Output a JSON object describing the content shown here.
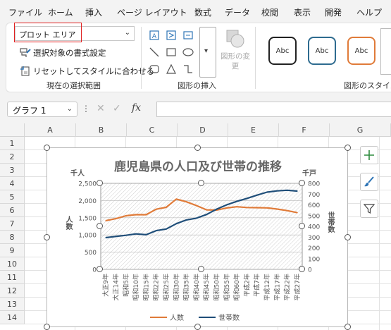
{
  "menubar": {
    "items": [
      {
        "label": "ファイル"
      },
      {
        "label": "ホーム"
      },
      {
        "label": "挿入"
      },
      {
        "label": "ページ レイアウト"
      },
      {
        "label": "数式"
      },
      {
        "label": "データ"
      },
      {
        "label": "校閲"
      },
      {
        "label": "表示"
      },
      {
        "label": "開発"
      },
      {
        "label": "ヘルプ"
      }
    ]
  },
  "ribbon": {
    "current_selection": {
      "element_select_value": "プロット エリア",
      "format_selection_label": "選択対象の書式設定",
      "reset_style_label": "リセットしてスタイルに合わせる",
      "group_label": "現在の選択範囲"
    },
    "insert_shapes": {
      "group_label": "図形の挿入",
      "change_shape_label": "図形の変更"
    },
    "shape_styles": {
      "group_label": "図形のスタイル",
      "style_sample": "Abc",
      "style_border_colors": [
        "#222222",
        "#2e6b8f",
        "#e07b39"
      ]
    }
  },
  "formula_bar": {
    "name_box": "グラフ 1",
    "fx_label": "fx",
    "formula": ""
  },
  "grid": {
    "columns": [
      "A",
      "B",
      "C",
      "D",
      "E",
      "F",
      "G"
    ],
    "rows": [
      "1",
      "2",
      "3",
      "4",
      "5",
      "6",
      "7",
      "8",
      "9",
      "10",
      "11",
      "12",
      "13",
      "14"
    ]
  },
  "chart": {
    "title": "鹿児島県の人口及び世帯の推移",
    "left_unit": "千人",
    "right_unit": "千戸",
    "left_axis_title": "人数",
    "right_axis_title": "世帯数",
    "legend": [
      {
        "name": "人数",
        "color": "#e07b39"
      },
      {
        "name": "世帯数",
        "color": "#1f4e79"
      }
    ]
  },
  "chart_data": {
    "type": "line",
    "title": "鹿児島県の人口及び世帯の推移",
    "categories": [
      "大正9年",
      "大正14年",
      "昭和5年",
      "昭和10年",
      "昭和15年",
      "昭和22年",
      "昭和25年",
      "昭和30年",
      "昭和35年",
      "昭和40年",
      "昭和45年",
      "昭和50年",
      "昭和55年",
      "昭和60年",
      "平成2年",
      "平成7年",
      "平成12年",
      "平成17年",
      "平成22年",
      "平成27年"
    ],
    "series": [
      {
        "name": "人数",
        "axis": "left",
        "color": "#e07b39",
        "values": [
          1415,
          1473,
          1557,
          1591,
          1589,
          1747,
          1804,
          2044,
          1963,
          1854,
          1729,
          1724,
          1785,
          1820,
          1798,
          1794,
          1786,
          1753,
          1706,
          1648
        ]
      },
      {
        "name": "世帯数",
        "axis": "right",
        "color": "#1f4e79",
        "values": [
          295,
          306,
          317,
          330,
          322,
          360,
          375,
          425,
          460,
          476,
          510,
          560,
          600,
          632,
          660,
          690,
          718,
          730,
          736,
          728
        ]
      }
    ],
    "left_axis": {
      "label": "人数",
      "unit": "千人",
      "ylim": [
        0,
        2500
      ],
      "ticks": [
        "0",
        "500",
        "1,000",
        "1,500",
        "2,000",
        "2,500"
      ]
    },
    "right_axis": {
      "label": "世帯数",
      "unit": "千戸",
      "ylim": [
        0,
        800
      ],
      "ticks": [
        "0",
        "100",
        "200",
        "300",
        "400",
        "500",
        "600",
        "700",
        "800"
      ]
    },
    "grid": true,
    "legend_position": "bottom"
  }
}
